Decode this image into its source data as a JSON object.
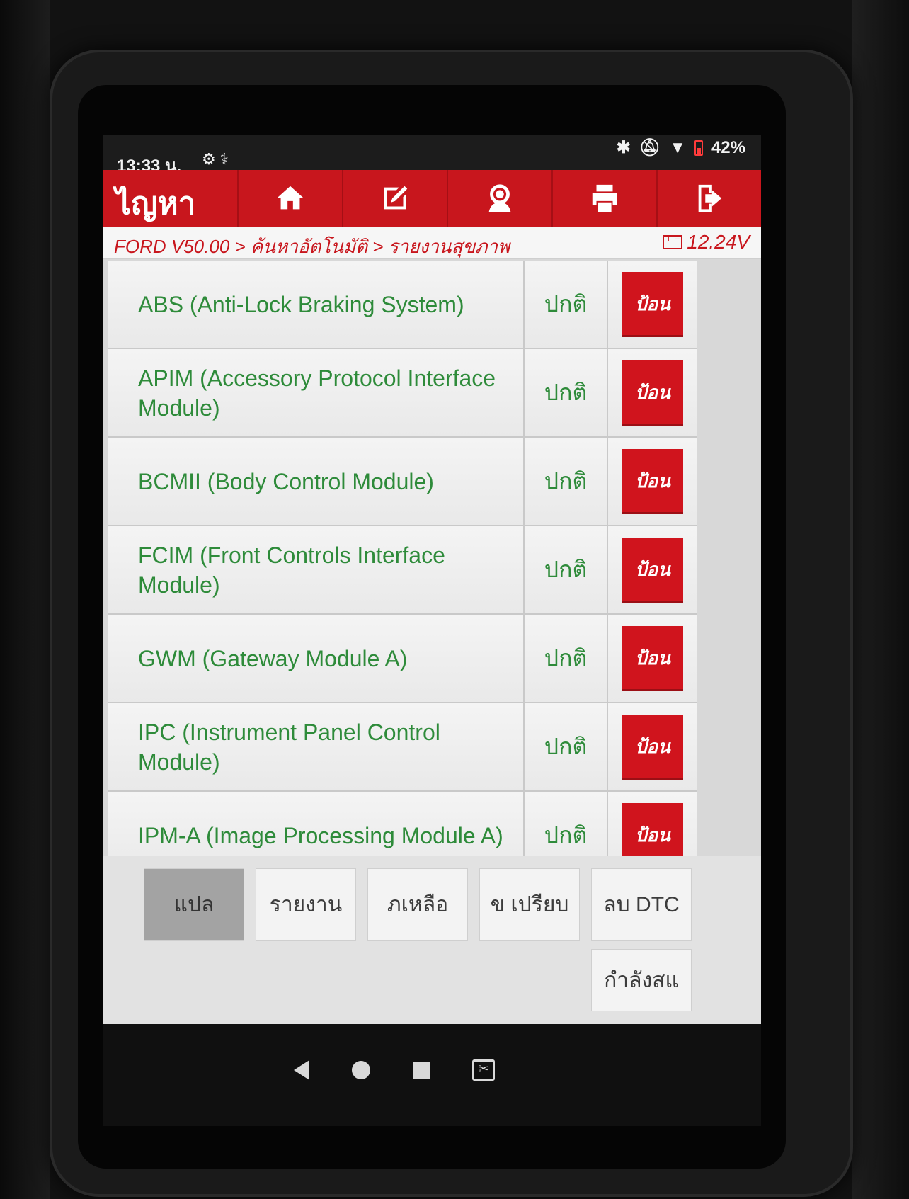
{
  "status_bar": {
    "time": "13:33 น.",
    "battery": "42%"
  },
  "header": {
    "title": "ไญหา",
    "tools": [
      "home-icon",
      "edit-icon",
      "support-icon",
      "print-icon",
      "exit-icon"
    ]
  },
  "breadcrumb": {
    "path": "FORD V50.00 > ค้นหาอัตโนมัติ > รายงานสุขภาพ",
    "voltage": "12.24V"
  },
  "modules": [
    {
      "name": "ABS (Anti-Lock Braking System)",
      "status": "ปกติ",
      "action": "ป้อน"
    },
    {
      "name": "APIM (Accessory Protocol Interface Module)",
      "status": "ปกติ",
      "action": "ป้อน"
    },
    {
      "name": "BCMII (Body Control Module)",
      "status": "ปกติ",
      "action": "ป้อน"
    },
    {
      "name": "FCIM (Front Controls Interface Module)",
      "status": "ปกติ",
      "action": "ป้อน"
    },
    {
      "name": "GWM (Gateway Module A)",
      "status": "ปกติ",
      "action": "ป้อน"
    },
    {
      "name": "IPC (Instrument Panel Control Module)",
      "status": "ปกติ",
      "action": "ป้อน"
    },
    {
      "name": "IPM-A (Image Processing Module A)",
      "status": "ปกติ",
      "action": "ป้อน"
    }
  ],
  "bottom_buttons": [
    "แปล",
    "รายงาน",
    "ภเหลือ",
    "ข เปรียบ",
    "ลบ DTC"
  ],
  "bottom_extra": "กำลังสแ",
  "colors": {
    "brand_red": "#c8161d",
    "status_green": "#2e8b3a"
  }
}
